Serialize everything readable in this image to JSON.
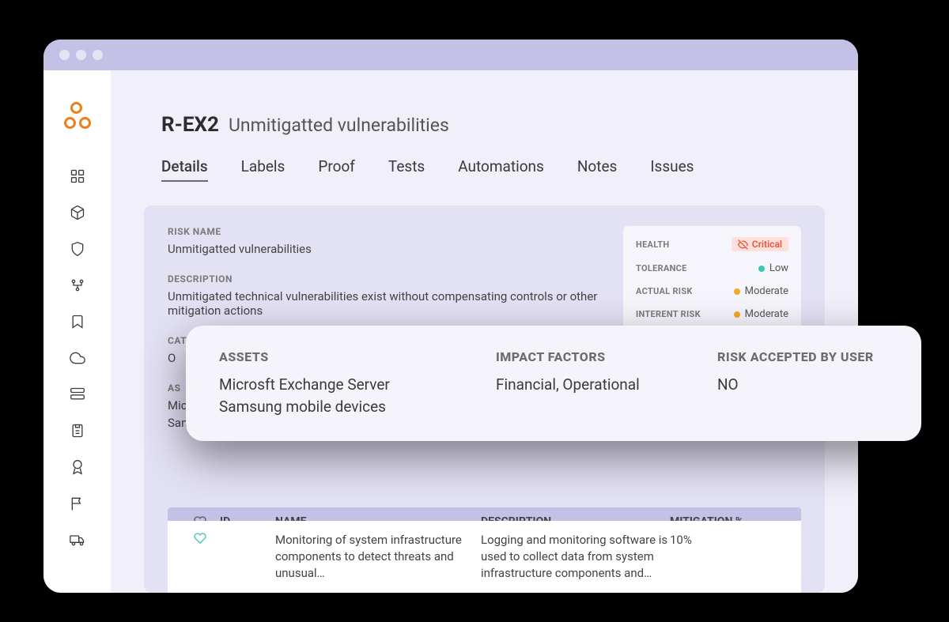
{
  "header": {
    "code": "R-EX2",
    "title": "Unmitigatted vulnerabilities"
  },
  "tabs": [
    "Details",
    "Labels",
    "Proof",
    "Tests",
    "Automations",
    "Notes",
    "Issues"
  ],
  "active_tab": 0,
  "details": {
    "risk_name_label": "RISK NAME",
    "risk_name_value": "Unmitigatted vulnerabilities",
    "description_label": "DESCRIPTION",
    "description_value": "Unmitigated technical vulnerabilities exist without compensating controls or other mitigation actions",
    "category_label": "CAT",
    "category_value": "O",
    "assets_hidden_label": "AS",
    "assets_hidden_line1": "Mic",
    "assets_hidden_line2": "Samsung mobile devices"
  },
  "side_card": {
    "health_label": "HEALTH",
    "health_value": "Critical",
    "tolerance_label": "TOLERANCE",
    "tolerance_value": "Low",
    "actual_label": "ACTUAL RISK",
    "actual_value": "Moderate",
    "inherent_label": "INTERENT RISK",
    "inherent_value": "Moderate"
  },
  "table": {
    "headers": {
      "id": "ID",
      "name": "NAME",
      "description": "DESCRIPTION",
      "mitigation": "MITIGATION %"
    },
    "rows": [
      {
        "id": "",
        "name": "Monitoring of system infrastructure components to detect threats and unusual…",
        "description": "Logging and monitoring software is used to collect data from system infrastructure components and…",
        "mitigation": "10%"
      }
    ]
  },
  "popover": {
    "assets_label": "ASSETS",
    "assets_value": "Microsft Exchange Server\nSamsung mobile devices",
    "impact_label": "IMPACT FACTORS",
    "impact_value": "Financial, Operational",
    "accepted_label": "RISK ACCEPTED BY USER",
    "accepted_value": "NO"
  },
  "colors": {
    "accent_orange": "#ef7d1a",
    "lilac_bg": "#c3c1e6",
    "panel_bg": "#e3e1f4",
    "critical_bg": "#ffe0dc",
    "critical_fg": "#e8573f",
    "dot_low": "#3ac9b0",
    "dot_moderate": "#f4a72a"
  }
}
